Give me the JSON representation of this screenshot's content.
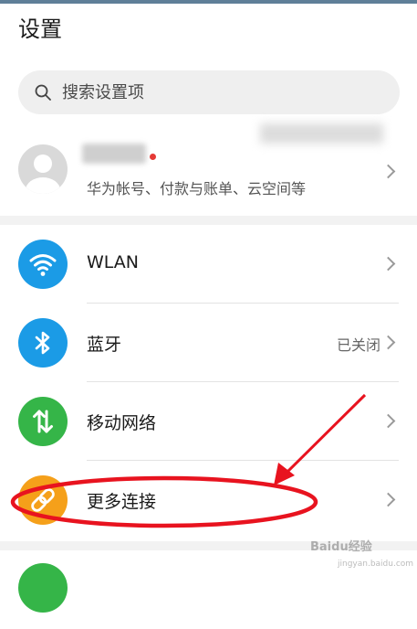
{
  "header": {
    "title": "设置"
  },
  "search": {
    "placeholder": "搜索设置项"
  },
  "account": {
    "subtitle": "华为帐号、付款与账单、云空间等",
    "name_redacted": true,
    "notification_dot_color": "#e53935"
  },
  "settings": {
    "items": [
      {
        "label": "WLAN",
        "value": "",
        "icon": "wifi-icon",
        "icon_color": "#1b9be6"
      },
      {
        "label": "蓝牙",
        "value": "已关闭",
        "icon": "bluetooth-icon",
        "icon_color": "#1b9be6"
      },
      {
        "label": "移动网络",
        "value": "",
        "icon": "mobile-data-icon",
        "icon_color": "#35b548"
      },
      {
        "label": "更多连接",
        "value": "",
        "icon": "link-icon",
        "icon_color": "#f5a01a"
      }
    ]
  },
  "annotation": {
    "color": "#e8131f",
    "highlighted_item": "更多连接"
  },
  "watermark": {
    "text": "Baidu经验",
    "sub": "jingyan.baidu.com"
  }
}
